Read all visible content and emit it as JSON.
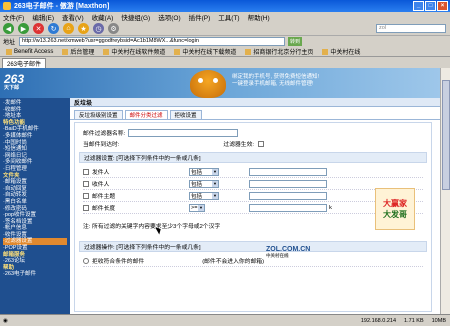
{
  "window": {
    "title": "263电子邮件 - 傲游 [Maxthon]"
  },
  "menu": [
    "文件(F)",
    "编辑(E)",
    "查看(V)",
    "收藏(A)",
    "快捷组(G)",
    "选项(O)",
    "插件(P)",
    "工具(T)",
    "帮助(H)"
  ],
  "search": {
    "placeholder": "zol"
  },
  "address": {
    "label": "地址",
    "value": "http://w13.263.net/xmweb?usr=ggodfreybsid=Ac1b1M8WX...&func=login",
    "go": "转到"
  },
  "favorites": [
    "Benefit Access",
    "后台管理",
    "中关村在线软件频道",
    "中关村在线下载频道",
    "招商银行北京分行主页",
    "中关村在线"
  ],
  "tab": {
    "label": "263电子邮件"
  },
  "banner": {
    "logo": "263",
    "logo_sub": "天下邮",
    "text_line1": "绑定我的手机号, 获得免费短信通知!",
    "text_line2": "一键登录手机邮箱, 无线邮件管理!"
  },
  "sidebar": {
    "items": [
      "·发邮件",
      "·收邮件",
      "·地址本",
      "特色功能",
      "·BaiD手机邮件",
      "·多媒体邮件",
      "·中国时尚",
      "·短信通知",
      "·网络日记",
      "·多间收邮件",
      "·日程管理",
      "文件夹",
      "·邮箱设置",
      "·自动回复",
      "·自动转发",
      "·黑白名单",
      "·修改密码",
      "·pop收件设置",
      "·签名档设置",
      "·帐户信息",
      "·收件设置",
      "·过滤器设置",
      "·POP设置",
      "邮箱服务",
      "·263论坛",
      "帮助",
      "·263电子邮件"
    ]
  },
  "main": {
    "title": "反垃圾",
    "tabs": [
      "反垃圾级别设置",
      "邮件分类过滤",
      "拒收设置"
    ],
    "filter_name_label": "邮件过滤器名称:",
    "when_receive_label": "当邮件到达时:",
    "enabled_label": "过滤器生效:",
    "conditions_header": "过滤器设置: [可选择下列条件中的一条或几条]",
    "conditions": [
      {
        "label": "发件人",
        "op": "包括"
      },
      {
        "label": "收件人",
        "op": "包括"
      },
      {
        "label": "邮件主题",
        "op": "包括"
      },
      {
        "label": "邮件长度",
        "op": ">=",
        "unit": "k"
      }
    ],
    "note": "注: 所有过滤的关键字内容要求至少3个字母或2个汉字",
    "actions_header": "过滤器操作: [可选择下列条件中的一条或几条]",
    "action1": "拒收符合条件的邮件",
    "action1_hint": "(邮件不会进入你的邮箱)"
  },
  "ad": {
    "line1": "大赢家",
    "line2": "大发哥"
  },
  "zol": {
    "name": "ZOL.COM.CN",
    "sub": "中关村在线"
  },
  "status": {
    "ip": "192.168.0.214",
    "speed": "1.71 KB",
    "time": "10MB"
  }
}
